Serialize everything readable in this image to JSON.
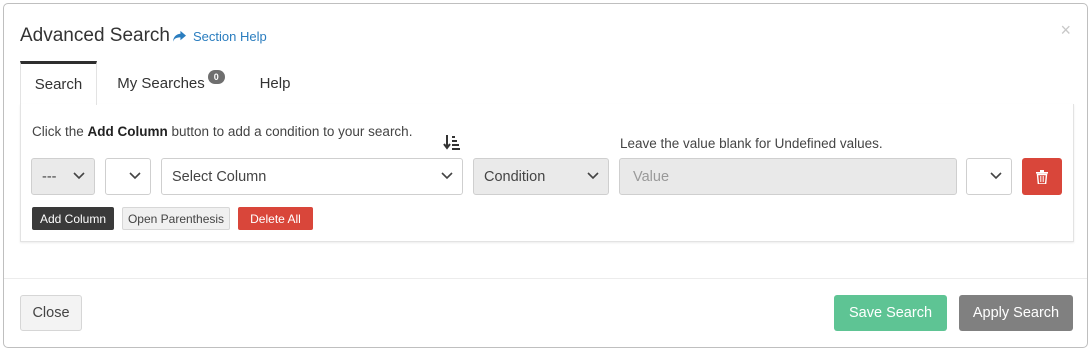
{
  "modal": {
    "title": "Advanced Search",
    "help_link": "Section Help",
    "close_symbol": "×"
  },
  "tabs": [
    {
      "label": "Search",
      "active": true
    },
    {
      "label": "My Searches",
      "badge": "0",
      "active": false
    },
    {
      "label": "Help",
      "active": false
    }
  ],
  "search": {
    "instruction_prefix": "Click the ",
    "instruction_bold": "Add Column",
    "instruction_suffix": " button to add a condition to your search.",
    "value_note": "Leave the value blank for Undefined values.",
    "row": {
      "open_paren_value": "---",
      "operator_value": "",
      "column_value": "Select Column",
      "condition_value": "Condition",
      "value_placeholder": "Value",
      "close_paren_value": ""
    },
    "buttons": {
      "add_column": "Add Column",
      "open_parenthesis": "Open Parenthesis",
      "delete_all": "Delete All"
    }
  },
  "footer": {
    "close": "Close",
    "save_search": "Save Search",
    "apply_search": "Apply Search"
  },
  "icons": {
    "help": "share-arrow-icon",
    "sort": "sort-descending-icon",
    "delete_row": "trash-icon",
    "dropdown": "chevron-down-icon"
  },
  "colors": {
    "link": "#2a7dbf",
    "danger": "#d9463a",
    "save": "#5ec494",
    "apply": "#808080",
    "dark_button": "#3a3a3a"
  }
}
